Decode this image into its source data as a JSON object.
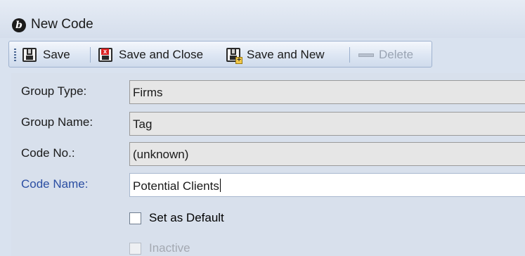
{
  "window": {
    "title": "New Code",
    "app_icon": "app-logo-icon"
  },
  "toolbar": {
    "save": {
      "label": "Save",
      "icon": "floppy-disk-icon"
    },
    "save_close": {
      "label": "Save and Close",
      "icon": "save-close-icon"
    },
    "save_new": {
      "label": "Save and New",
      "icon": "save-new-icon"
    },
    "delete": {
      "label": "Delete",
      "icon": "delete-icon"
    }
  },
  "form": {
    "group_type": {
      "label": "Group Type:",
      "value": "Firms"
    },
    "group_name": {
      "label": "Group Name:",
      "value": "Tag"
    },
    "code_no": {
      "label": "Code No.:",
      "value": "(unknown)"
    },
    "code_name": {
      "label": "Code Name:",
      "value": "Potential Clients"
    },
    "set_as_default": {
      "label": "Set as Default"
    },
    "inactive": {
      "label": "Inactive"
    }
  },
  "colors": {
    "required_label": "#2b4ea2",
    "toolbar_border": "#9fb2cf"
  }
}
